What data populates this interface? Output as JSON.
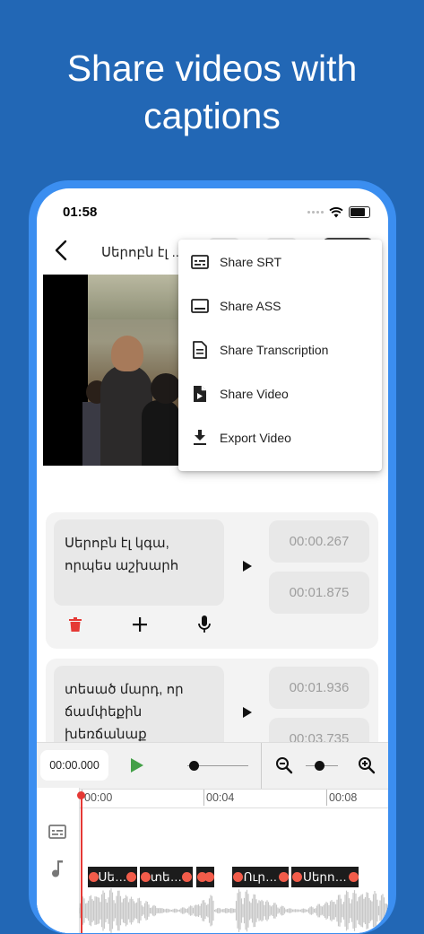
{
  "headline": {
    "line1": "Share videos with",
    "line2": "captions"
  },
  "status_bar": {
    "time": "01:58"
  },
  "app_bar": {
    "title": "Սերոբն էլ ..."
  },
  "share_menu": {
    "items": [
      {
        "label": "Share SRT",
        "icon": "subtitles-icon"
      },
      {
        "label": "Share ASS",
        "icon": "caption-box-icon"
      },
      {
        "label": "Share Transcription",
        "icon": "document-icon"
      },
      {
        "label": "Share Video",
        "icon": "video-file-icon"
      },
      {
        "label": "Export Video",
        "icon": "download-icon"
      }
    ]
  },
  "captions": [
    {
      "text_line1": "Սերոբն էլ կգա,",
      "text_line2": "որպես աշխարհ",
      "start": "00:00.267",
      "end": "00:01.875"
    },
    {
      "text_line1": "տեսած մարդ, որ",
      "text_line2": "ճամփեքին",
      "text_line3": "խեռճանաք",
      "start": "00:01.936",
      "end": "00:03.735"
    }
  ],
  "editor": {
    "current_time": "00:00.000",
    "ruler_labels": [
      "00:00",
      "00:04",
      "00:08"
    ],
    "timeline_captions": [
      "Սե…",
      "տե…",
      "",
      "Ուր…",
      "Սերո…"
    ]
  },
  "colors": {
    "background": "#2267b5",
    "phone_frame": "#3b8ef0",
    "delete_red": "#e53935",
    "play_green": "#43a047",
    "caption_marker": "#f25c4a"
  }
}
